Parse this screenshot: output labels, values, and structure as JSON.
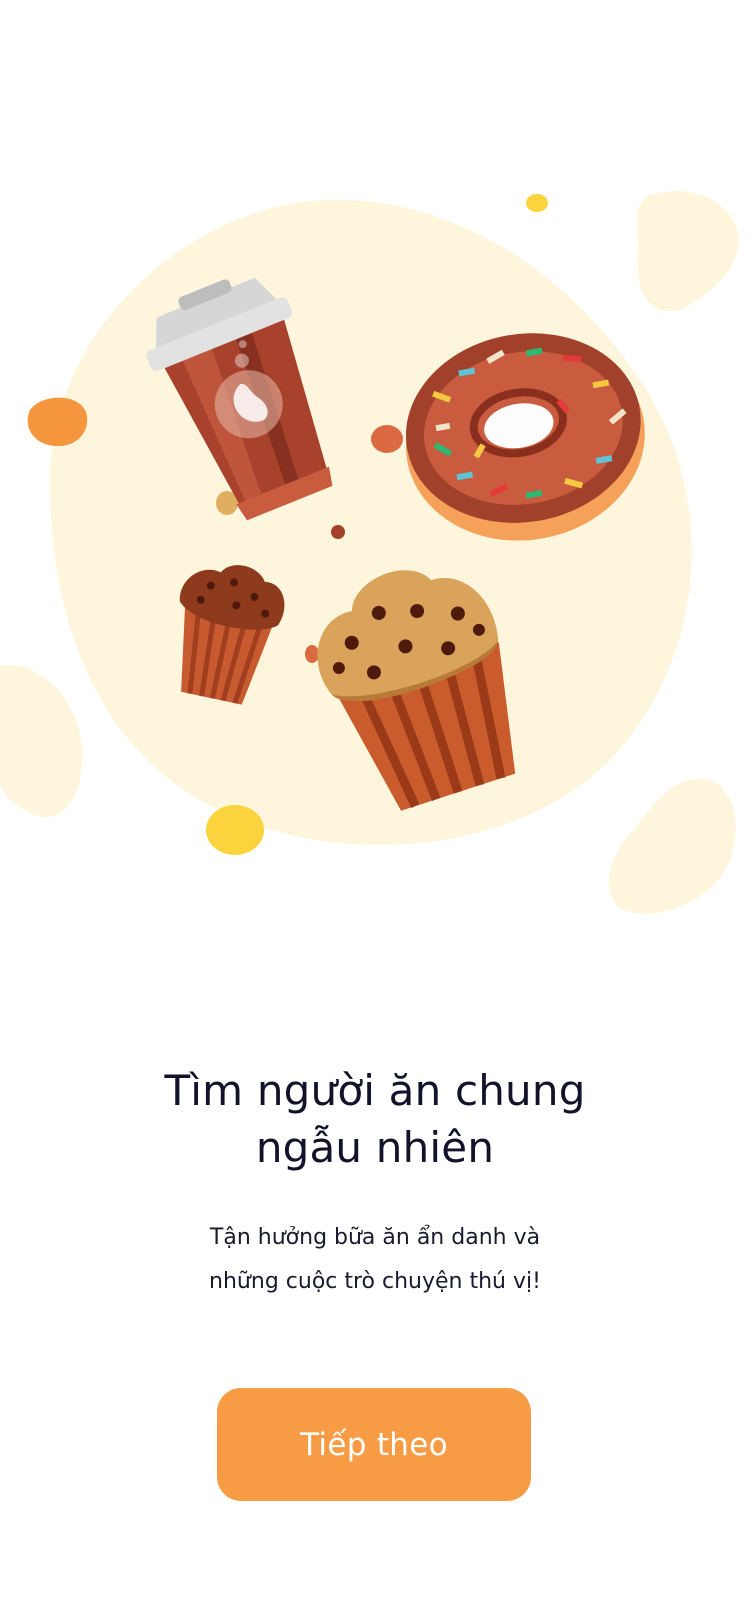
{
  "onboarding": {
    "title_line1": "Tìm người ăn chung",
    "title_line2": "ngẫu nhiên",
    "subtitle_line1": "Tận hưởng bữa ăn ẩn danh và",
    "subtitle_line2": "những cuộc trò chuyện thú vị!",
    "next_label": "Tiếp theo"
  },
  "colors": {
    "accent": "#f79b45",
    "title_text": "#12122a",
    "blob_cream": "#fdf6dc",
    "blob_yellow": "#fbd33d",
    "blob_orange": "#f5963f"
  },
  "illustration": {
    "items": [
      "coffee-cup-icon",
      "donut-icon",
      "small-muffin-icon",
      "large-muffin-icon"
    ]
  }
}
